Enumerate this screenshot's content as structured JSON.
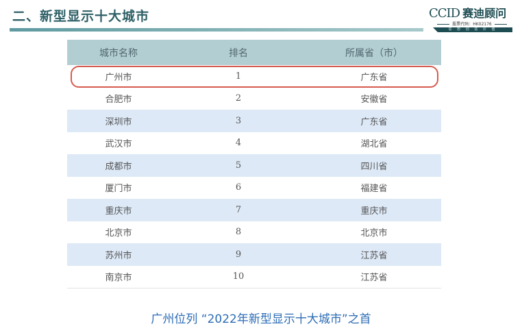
{
  "header": {
    "title": "二、新型显示十大城市",
    "logo": {
      "brand_latin": "CCID",
      "brand_cn": "赛迪顾问",
      "stock_code": "股票代码：HK02176",
      "tagline": "思 想 创 造 价 值"
    }
  },
  "table": {
    "headers": [
      "城市名称",
      "排名",
      "所属省（市）"
    ],
    "rows": [
      {
        "city": "广州市",
        "rank": "1",
        "province": "广东省"
      },
      {
        "city": "合肥市",
        "rank": "2",
        "province": "安徽省"
      },
      {
        "city": "深圳市",
        "rank": "3",
        "province": "广东省"
      },
      {
        "city": "武汉市",
        "rank": "4",
        "province": "湖北省"
      },
      {
        "city": "成都市",
        "rank": "5",
        "province": "四川省"
      },
      {
        "city": "厦门市",
        "rank": "6",
        "province": "福建省"
      },
      {
        "city": "重庆市",
        "rank": "7",
        "province": "重庆市"
      },
      {
        "city": "北京市",
        "rank": "8",
        "province": "北京市"
      },
      {
        "city": "苏州市",
        "rank": "9",
        "province": "江苏省"
      },
      {
        "city": "南京市",
        "rank": "10",
        "province": "江苏省"
      }
    ]
  },
  "caption": "广州位列 “2022年新型显示十大城市”之首",
  "colors": {
    "header_row": "#b3ced2",
    "alt_row": "#dde9f7",
    "highlight_border": "#d65a4e",
    "caption": "#2c6cb5",
    "title": "#2d5f66"
  }
}
